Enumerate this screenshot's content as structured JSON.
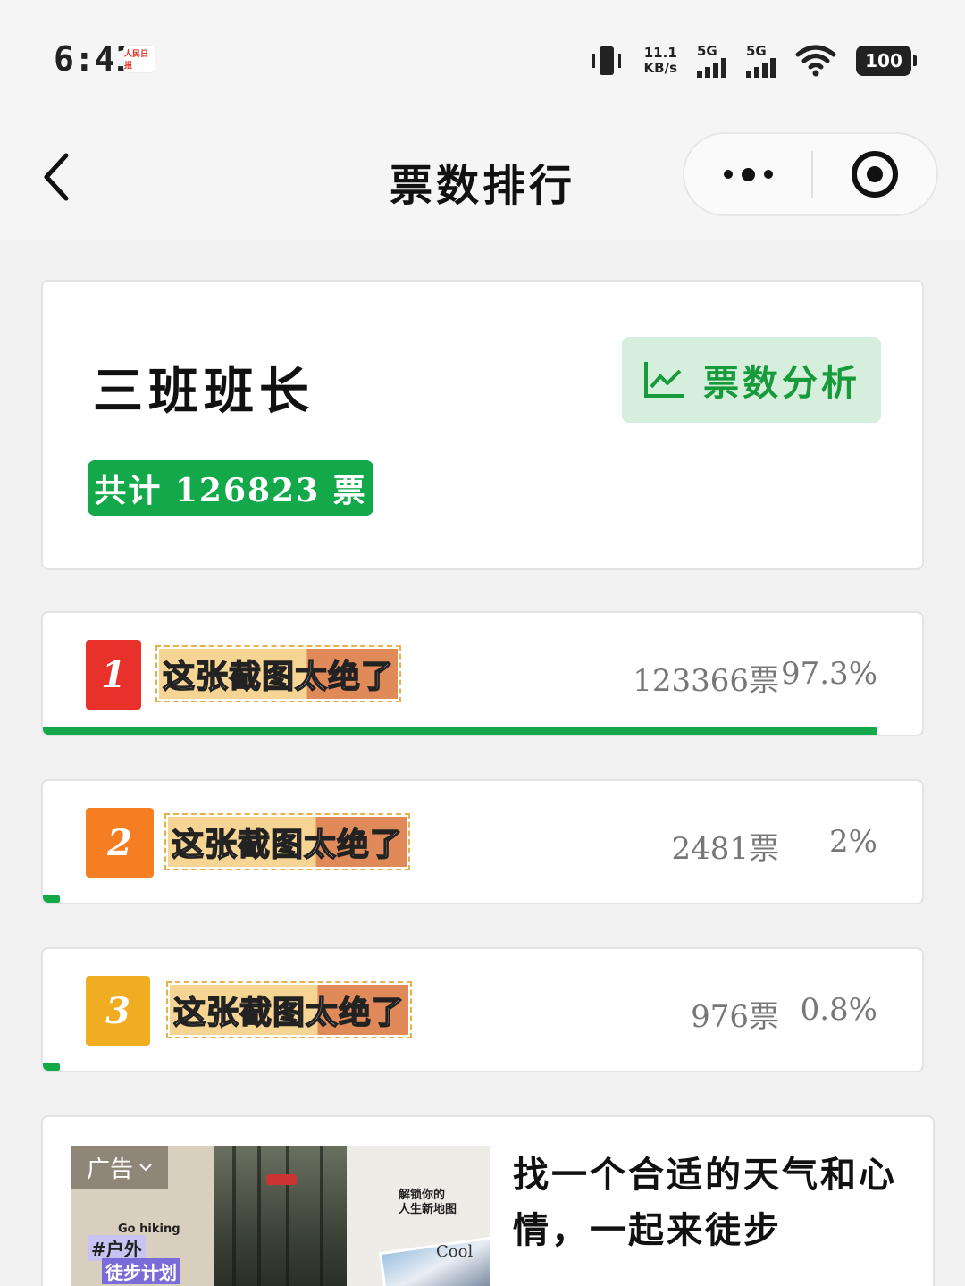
{
  "status_bar": {
    "time": "6:41",
    "app_badge": "人民日报",
    "net_speed_value": "11.1",
    "net_speed_unit": "KB/s",
    "signal_1_label": "5G",
    "signal_2_label": "5G",
    "battery": "100"
  },
  "nav": {
    "title": "票数排行"
  },
  "summary": {
    "candidate": "三班班长",
    "analysis_label": "票数分析",
    "total_label": "共计 126823 票",
    "accent_color": "#13a84a"
  },
  "rankings": [
    {
      "rank": "1",
      "name": "这张截图太绝了",
      "votes": "123366票",
      "percent": "97.3%",
      "share": 0.973,
      "badge_color": "#e8312a"
    },
    {
      "rank": "2",
      "name": "这张截图太绝了",
      "votes": "2481票",
      "percent": "2%",
      "share": 0.02,
      "badge_color": "#f57e22"
    },
    {
      "rank": "3",
      "name": "这张截图太绝了",
      "votes": "976票",
      "percent": "0.8%",
      "share": 0.008,
      "badge_color": "#f0ad22"
    }
  ],
  "ad": {
    "label": "广告",
    "image_go": "Go hiking",
    "image_tag": "#户外",
    "image_plan": "徒步计划",
    "image_unlock": "解锁你的\n人生新地图",
    "image_cool": "Cool",
    "text": "找一个合适的天气和心情，一起来徒步"
  }
}
